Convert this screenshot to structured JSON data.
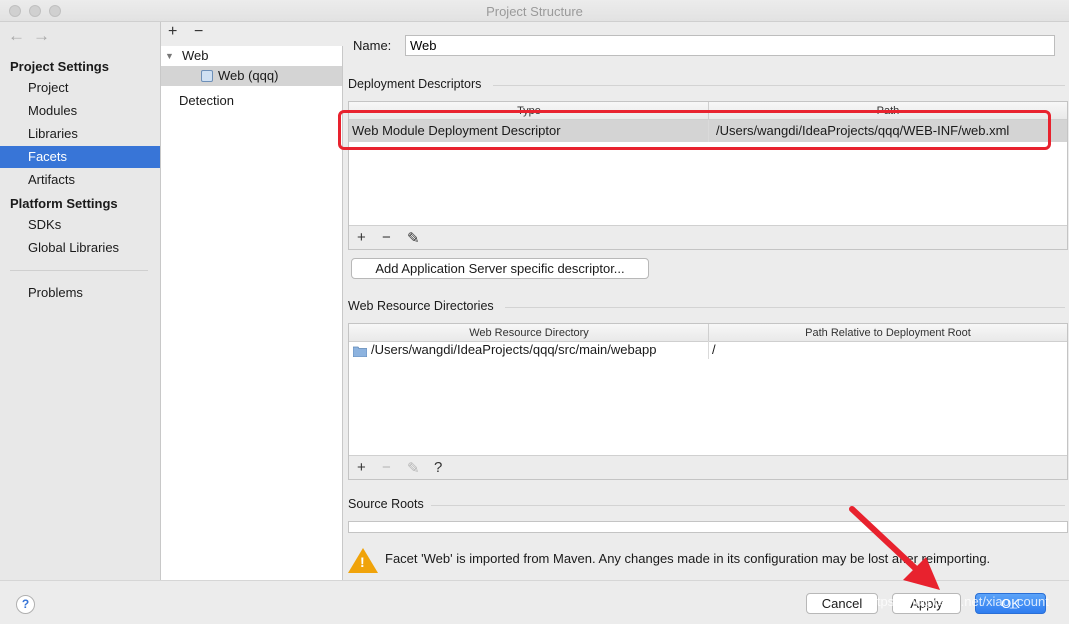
{
  "window": {
    "title": "Project Structure"
  },
  "nav": {
    "back_glyph": "←",
    "forward_glyph": "→",
    "project_settings_header": "Project Settings",
    "project_items": [
      "Project",
      "Modules",
      "Libraries",
      "Facets",
      "Artifacts"
    ],
    "selected_item": "Facets",
    "platform_settings_header": "Platform Settings",
    "platform_items": [
      "SDKs",
      "Global Libraries"
    ],
    "problems": "Problems"
  },
  "facets_tree": {
    "add_glyph": "+",
    "remove_glyph": "−",
    "group": "Web",
    "child": "Web (qqq)",
    "detection": "Detection"
  },
  "facet": {
    "name_label": "Name:",
    "name_value": "Web",
    "deployment_descriptors": {
      "title": "Deployment Descriptors",
      "columns": [
        "Type",
        "Path"
      ],
      "rows": [
        {
          "type": "Web Module Deployment Descriptor",
          "path": "/Users/wangdi/IdeaProjects/qqq/WEB-INF/web.xml"
        }
      ],
      "tools": [
        "+",
        "−",
        "✎"
      ],
      "add_server_button": "Add Application Server specific descriptor..."
    },
    "web_resource_directories": {
      "title": "Web Resource Directories",
      "columns": [
        "Web Resource Directory",
        "Path Relative to Deployment Root"
      ],
      "rows": [
        {
          "directory": "/Users/wangdi/IdeaProjects/qqq/src/main/webapp",
          "relative_path": "/"
        }
      ],
      "tools": [
        "+",
        "−",
        "✎",
        "?"
      ]
    },
    "source_roots": {
      "title": "Source Roots"
    },
    "warning": "Facet 'Web' is imported from Maven. Any changes made in its configuration may be lost after reimporting."
  },
  "footer": {
    "help": "?",
    "cancel": "Cancel",
    "apply": "Apply",
    "ok": "OK"
  },
  "watermark": "https://blog.csdn.net/xiao_count",
  "colors": {
    "selection": "#3875d7",
    "highlight_box": "#e8222e",
    "arrow": "#e8222e",
    "warning": "#f0a30a"
  }
}
